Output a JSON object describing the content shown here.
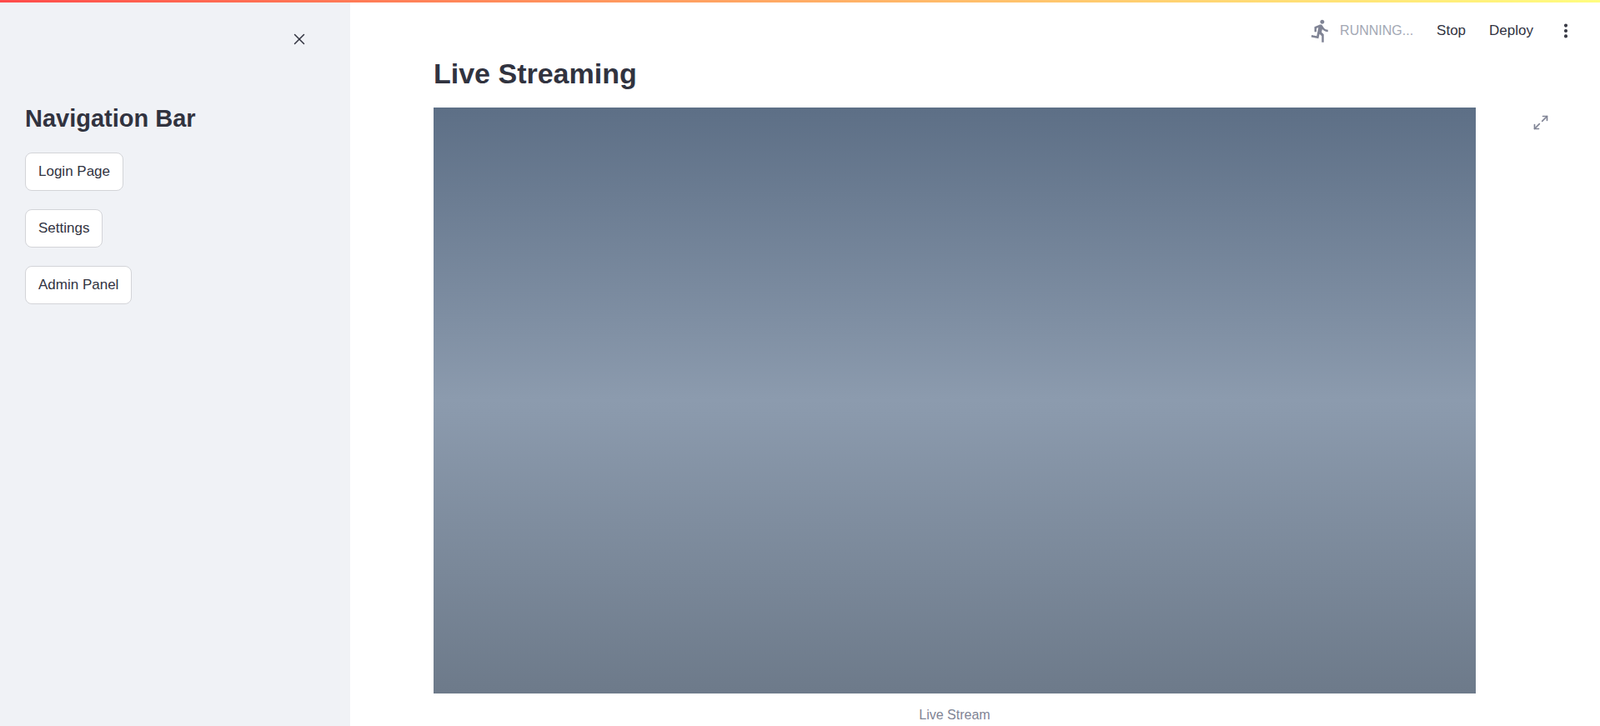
{
  "window": {
    "title": "Live Streaming"
  },
  "header": {
    "status": "RUNNING...",
    "actions": [
      "Stop",
      "Deploy"
    ]
  },
  "sidebar": {
    "title": "Navigation Bar",
    "items": [
      "Login Page",
      "Settings",
      "Admin Panel"
    ]
  },
  "main": {
    "title": "Live Streaming",
    "caption": "Live Stream"
  }
}
